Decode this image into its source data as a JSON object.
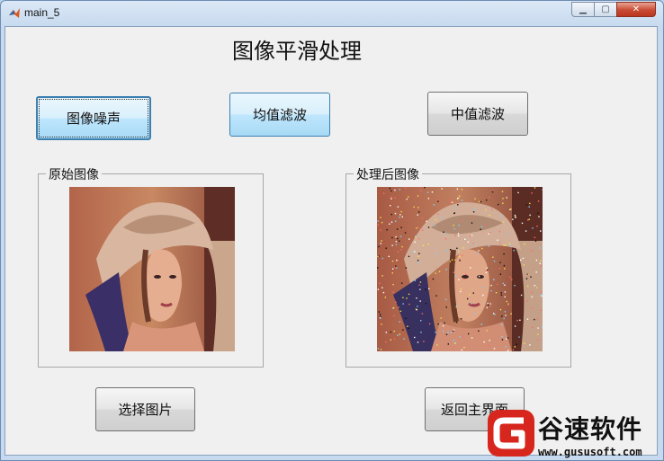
{
  "window": {
    "title": "main_5",
    "minimize_glyph": "▁",
    "maximize_glyph": "▢",
    "close_glyph": "✕"
  },
  "main": {
    "heading": "图像平滑处理",
    "buttons": {
      "noise": "图像噪声",
      "mean_filter": "均值滤波",
      "median_filter": "中值滤波",
      "select_image": "选择图片",
      "back_to_main": "返回主界面"
    },
    "panels": {
      "original": "原始图像",
      "processed": "处理后图像"
    }
  },
  "watermark": {
    "name": "谷速软件",
    "url": "www.gususoft.com",
    "brand_color": "#d7261e"
  }
}
